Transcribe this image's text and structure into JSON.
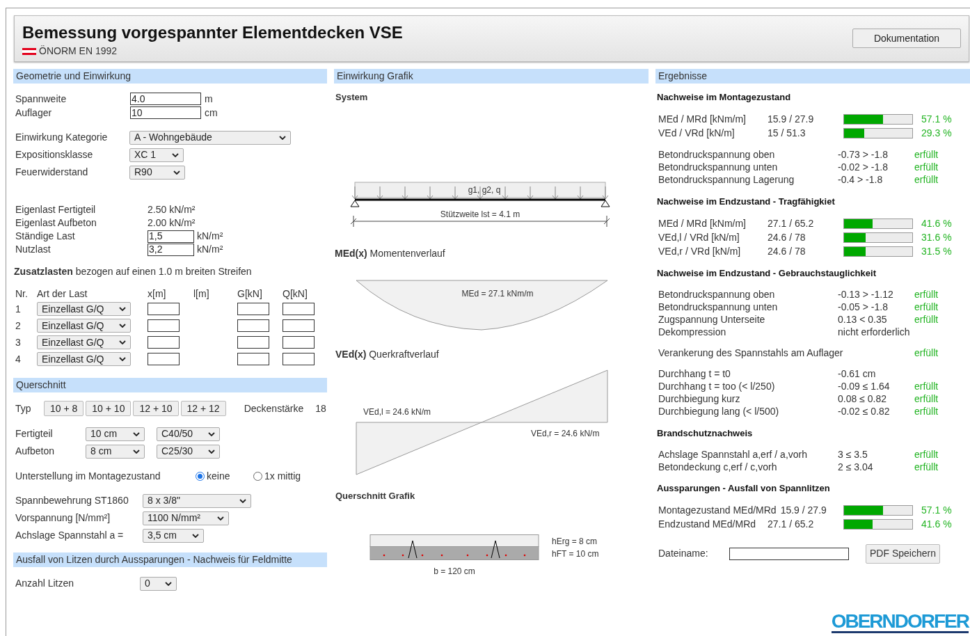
{
  "header": {
    "title": "Bemessung vorgespannter Elementdecken VSE",
    "norm": "ÖNORM EN 1992",
    "doc_button": "Dokumentation"
  },
  "geometry": {
    "heading": "Geometrie und Einwirkung",
    "inputs": [
      {
        "label": "Spannweite",
        "value": "4.0",
        "unit": "m"
      },
      {
        "label": "Auflager",
        "value": "10",
        "unit": "cm"
      }
    ],
    "selects": [
      {
        "label": "Einwirkung Kategorie",
        "value": "A - Wohngebäude"
      },
      {
        "label": "Expositionsklasse",
        "value": "XC 1"
      },
      {
        "label": "Feuerwiderstand",
        "value": "R90"
      }
    ],
    "loads": [
      {
        "kind": "static",
        "label": "Eigenlast Fertigteil",
        "value": "2.50 kN/m²"
      },
      {
        "kind": "static",
        "label": "Eigenlast Aufbeton",
        "value": "2.00 kN/m²"
      },
      {
        "kind": "input",
        "label": "Ständige Last",
        "value": "1,5",
        "unit": "kN/m²"
      },
      {
        "kind": "input",
        "label": "Nutzlast",
        "value": "3,2",
        "unit": "kN/m²"
      }
    ]
  },
  "extra_loads": {
    "title": "**Zusatzlasten** bezogen auf einen 1.0 m breiten Streifen",
    "columns": [
      "Nr.",
      "Art der Last",
      "x[m]",
      "l[m]",
      "G[kN]",
      "Q[kN]"
    ],
    "rows": [
      {
        "nr": "1",
        "type": "Einzellast G/Q"
      },
      {
        "nr": "2",
        "type": "Einzellast G/Q"
      },
      {
        "nr": "3",
        "type": "Einzellast G/Q"
      },
      {
        "nr": "4",
        "type": "Einzellast G/Q"
      }
    ]
  },
  "section": {
    "heading": "Querschnitt",
    "typ_label": "Typ",
    "types": [
      "10 + 8",
      "10 + 10",
      "12 + 10",
      "12 + 12"
    ],
    "thickness_label": "Deckenstärke",
    "thickness": "18",
    "layers": [
      {
        "label": "Fertigteil",
        "thickness": "10 cm",
        "concrete": "C40/50"
      },
      {
        "label": "Aufbeton",
        "thickness": "8 cm",
        "concrete": "C25/30"
      }
    ],
    "support": {
      "label": "Unterstellung im Montagezustand",
      "options": [
        {
          "label": "keine",
          "selected": true
        },
        {
          "label": "1x mittig",
          "selected": false
        }
      ]
    },
    "prestress": [
      {
        "label": "Spannbewehrung ST1860",
        "value": "8 x 3/8\""
      },
      {
        "label": "Vorspannung [N/mm²]",
        "value": "1100 N/mm²"
      },
      {
        "label": "Achslage Spannstahl a =",
        "value": "3,5 cm"
      }
    ]
  },
  "failure": {
    "heading": "Ausfall von Litzen durch Aussparungen - Nachweis für Feldmitte",
    "label": "Anzahl Litzen",
    "value": "0"
  },
  "graphics": {
    "heading": "Einwirkung Grafik",
    "system_title": "System",
    "load_label": "g1, g2, q",
    "span_label": "Stützweite lst = 4.1 m",
    "moment_title": "**MEd(x)** Momentenverlauf",
    "moment_label": "MEd = 27.1 kNm/m",
    "shear_title": "**VEd(x)** Querkraftverlauf",
    "shear_left": "VEd,l = 24.6 kN/m",
    "shear_right": "VEd,r = 24.6 kN/m",
    "section_title": "Querschnitt Grafik",
    "h_topping": "hErg = 8 cm",
    "h_precast": "hFT = 10 cm",
    "width": "b = 120 cm"
  },
  "results": {
    "heading": "Ergebnisse",
    "groups": [
      {
        "title": "Nachweise im Montagezustand",
        "rows": [
          {
            "kind": "bar",
            "label": "MEd / MRd [kNm/m]",
            "value": "15.9 / 27.9",
            "level": 0.571,
            "percent": "57.1 %"
          },
          {
            "kind": "bar",
            "label": "VEd / VRd [kN/m]",
            "value": "15 / 51.3",
            "level": 0.293,
            "percent": "29.3 %"
          }
        ]
      },
      {
        "rows": [
          {
            "kind": "check",
            "label": "Betondruckspannung oben",
            "value": "-0.73 > -1.8",
            "status": "erfüllt"
          },
          {
            "kind": "check",
            "label": "Betondruckspannung unten",
            "value": "-0.02 > -1.8",
            "status": "erfüllt"
          },
          {
            "kind": "check",
            "label": "Betondruckspannung Lagerung",
            "value": "-0.4 > -1.8",
            "status": "erfüllt"
          }
        ]
      },
      {
        "title": "Nachweise im Endzustand - Tragfähigkiet",
        "rows": [
          {
            "kind": "bar",
            "label": "MEd / MRd [kNm/m]",
            "value": "27.1 / 65.2",
            "level": 0.416,
            "percent": "41.6 %"
          },
          {
            "kind": "bar",
            "label": "VEd,l / VRd [kN/m]",
            "value": "24.6 / 78",
            "level": 0.316,
            "percent": "31.6 %"
          },
          {
            "kind": "bar",
            "label": "VEd,r / VRd [kN/m]",
            "value": "24.6 / 78",
            "level": 0.315,
            "percent": "31.5 %"
          }
        ]
      },
      {
        "title": "Nachweise im Endzustand - Gebrauchstauglichkeit",
        "rows": [
          {
            "kind": "check",
            "label": "Betondruckspannung oben",
            "value": "-0.13 > -1.12",
            "status": "erfüllt"
          },
          {
            "kind": "check",
            "label": "Betondruckspannung unten",
            "value": "-0.05 > -1.8",
            "status": "erfüllt"
          },
          {
            "kind": "check",
            "label": "Zugspannung Unterseite",
            "value": "0.13 < 0.35",
            "status": "erfüllt"
          },
          {
            "kind": "check",
            "label": "Dekompression",
            "value": "nicht erforderlich"
          }
        ]
      },
      {
        "rows": [
          {
            "kind": "check",
            "label": "Verankerung des Spannstahls am Auflager",
            "status": "erfüllt"
          }
        ]
      },
      {
        "rows": [
          {
            "kind": "check",
            "label": "Durchhang t = t0",
            "value": "-0.61 cm"
          },
          {
            "kind": "check",
            "label": "Durchhang t = too (< l/250)",
            "value": "-0.09 ≤ 1.64",
            "status": "erfüllt"
          },
          {
            "kind": "check",
            "label": "Durchbiegung kurz",
            "value": "0.08 ≤ 0.82",
            "status": "erfüllt"
          },
          {
            "kind": "check",
            "label": "Durchbiegung lang (< l/500)",
            "value": "-0.02 ≤ 0.82",
            "status": "erfüllt"
          }
        ]
      },
      {
        "title": "Brandschutznachweis",
        "rows": [
          {
            "kind": "check",
            "label": "Achslage Spannstahl a,erf / a,vorh",
            "value": "3 ≤ 3.5",
            "status": "erfüllt"
          },
          {
            "kind": "check",
            "label": "Betondeckung c,erf / c,vorh",
            "value": "2 ≤ 3.04",
            "status": "erfüllt"
          }
        ]
      },
      {
        "title": "Aussparungen - Ausfall von Spannlitzen",
        "rows": [
          {
            "kind": "bar",
            "label": "Montagezustand MEd/MRd",
            "value": "15.9 / 27.9",
            "level": 0.571,
            "percent": "57.1 %"
          },
          {
            "kind": "bar",
            "label": "Endzustand MEd/MRd",
            "value": "27.1 / 65.2",
            "level": 0.416,
            "percent": "41.6 %"
          }
        ]
      }
    ],
    "file_label": "Dateiname:",
    "pdf_button": "PDF Speichern"
  },
  "logo": "OBERNDORFER"
}
